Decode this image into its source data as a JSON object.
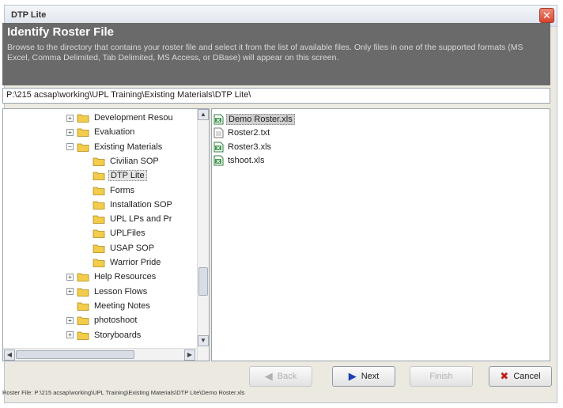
{
  "window": {
    "title": "DTP Lite",
    "close_glyph": "✕"
  },
  "header": {
    "title": "Identify Roster File",
    "description": "Browse to the directory that contains your roster file and select it from the list of available files. Only files in one of the supported formats (MS Excel, Comma Delimited, Tab Delimited, MS Access, or DBase) will appear on this screen."
  },
  "path": "P:\\215 acsap\\working\\UPL Training\\Existing Materials\\DTP Lite\\",
  "tree": [
    {
      "label": "Development Resou",
      "expander": "+",
      "selected": false
    },
    {
      "label": "Evaluation",
      "expander": "+",
      "selected": false
    },
    {
      "label": "Existing Materials",
      "expander": "−",
      "selected": false
    },
    {
      "label": "Civilian SOP",
      "expander": "",
      "selected": false
    },
    {
      "label": "DTP Lite",
      "expander": "",
      "selected": true
    },
    {
      "label": "Forms",
      "expander": "",
      "selected": false
    },
    {
      "label": "Installation SOP",
      "expander": "",
      "selected": false
    },
    {
      "label": "UPL LPs and Pr",
      "expander": "",
      "selected": false
    },
    {
      "label": "UPLFiles",
      "expander": "",
      "selected": false
    },
    {
      "label": "USAP SOP",
      "expander": "",
      "selected": false
    },
    {
      "label": "Warrior Pride",
      "expander": "",
      "selected": false
    },
    {
      "label": "Help Resources",
      "expander": "+",
      "selected": false
    },
    {
      "label": "Lesson Flows",
      "expander": "+",
      "selected": false
    },
    {
      "label": "Meeting Notes",
      "expander": "",
      "selected": false
    },
    {
      "label": "photoshoot",
      "expander": "+",
      "selected": false
    },
    {
      "label": "Storyboards",
      "expander": "+",
      "selected": false
    }
  ],
  "files": [
    {
      "label": "Demo Roster.xls",
      "icon": "excel-file-icon",
      "selected": true
    },
    {
      "label": "Roster2.txt",
      "icon": "text-file-icon",
      "selected": false
    },
    {
      "label": "Roster3.xls",
      "icon": "excel-file-icon",
      "selected": false
    },
    {
      "label": "tshoot.xls",
      "icon": "excel-file-icon",
      "selected": false
    }
  ],
  "buttons": {
    "back": "Back",
    "next": "Next",
    "finish": "Finish",
    "cancel": "Cancel"
  },
  "status": "Roster File: P:\\215 acsap\\working\\UPL Training\\Existing Materials\\DTP Lite\\Demo Roster.xls",
  "colors": {
    "header_bg": "#6a6a6a",
    "next_arrow": "#1a3fb5",
    "cancel_x": "#c0201a",
    "folder": "#f2cc4a"
  }
}
